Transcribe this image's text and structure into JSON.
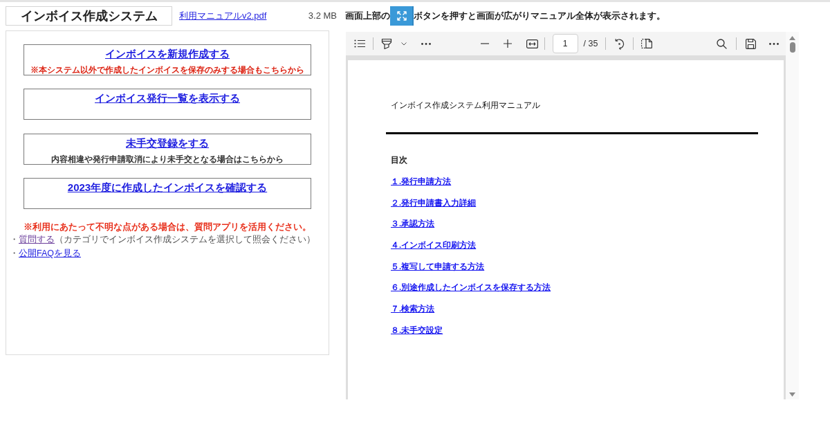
{
  "header": {
    "title": "インボイス作成システム",
    "manual_link": "利用マニュアルv2.pdf",
    "file_size": "3.2 MB",
    "instruction": {
      "before_icon": "画面上部の",
      "after_icon": "ボタンを押すと画面が広がりマニュアル全体が表示されます。"
    }
  },
  "menu": [
    {
      "label": "インボイスを新規作成する",
      "note": {
        "kind": "warning",
        "text": "※本システム以外で作成したインボイスを保存のみする場合もこちらから"
      }
    },
    {
      "label": "インボイス発行一覧を表示する"
    },
    {
      "label": "未手交登録をする",
      "note": {
        "kind": "info",
        "text": "内容相違や発行申請取消により未手交となる場合はこちらから"
      }
    },
    {
      "label": "2023年度に作成したインボイスを確認する"
    }
  ],
  "help": {
    "notice": "※利用にあたって不明な点がある場合は、質問アプリを活用ください。",
    "links": [
      {
        "bullet": "・",
        "label": "質問する",
        "visited": true,
        "description": "（カテゴリでインボイス作成システムを選択して照会ください）"
      },
      {
        "bullet": "・",
        "label": "公開FAQを見る",
        "visited": false
      }
    ]
  },
  "pdf_viewer": {
    "page_number": "1",
    "page_total": "/ 35",
    "document": {
      "title": "インボイス作成システム利用マニュアル",
      "toc_heading": "目次",
      "toc": [
        "１.発行申請方法",
        "２.発行申請書入力詳細",
        "３.承認方法",
        "４.インボイス印刷方法",
        "５.複写して申請する方法",
        "６.別途作成したインボイスを保存する方法",
        "７.検索方法",
        "８.未手交設定"
      ]
    }
  }
}
